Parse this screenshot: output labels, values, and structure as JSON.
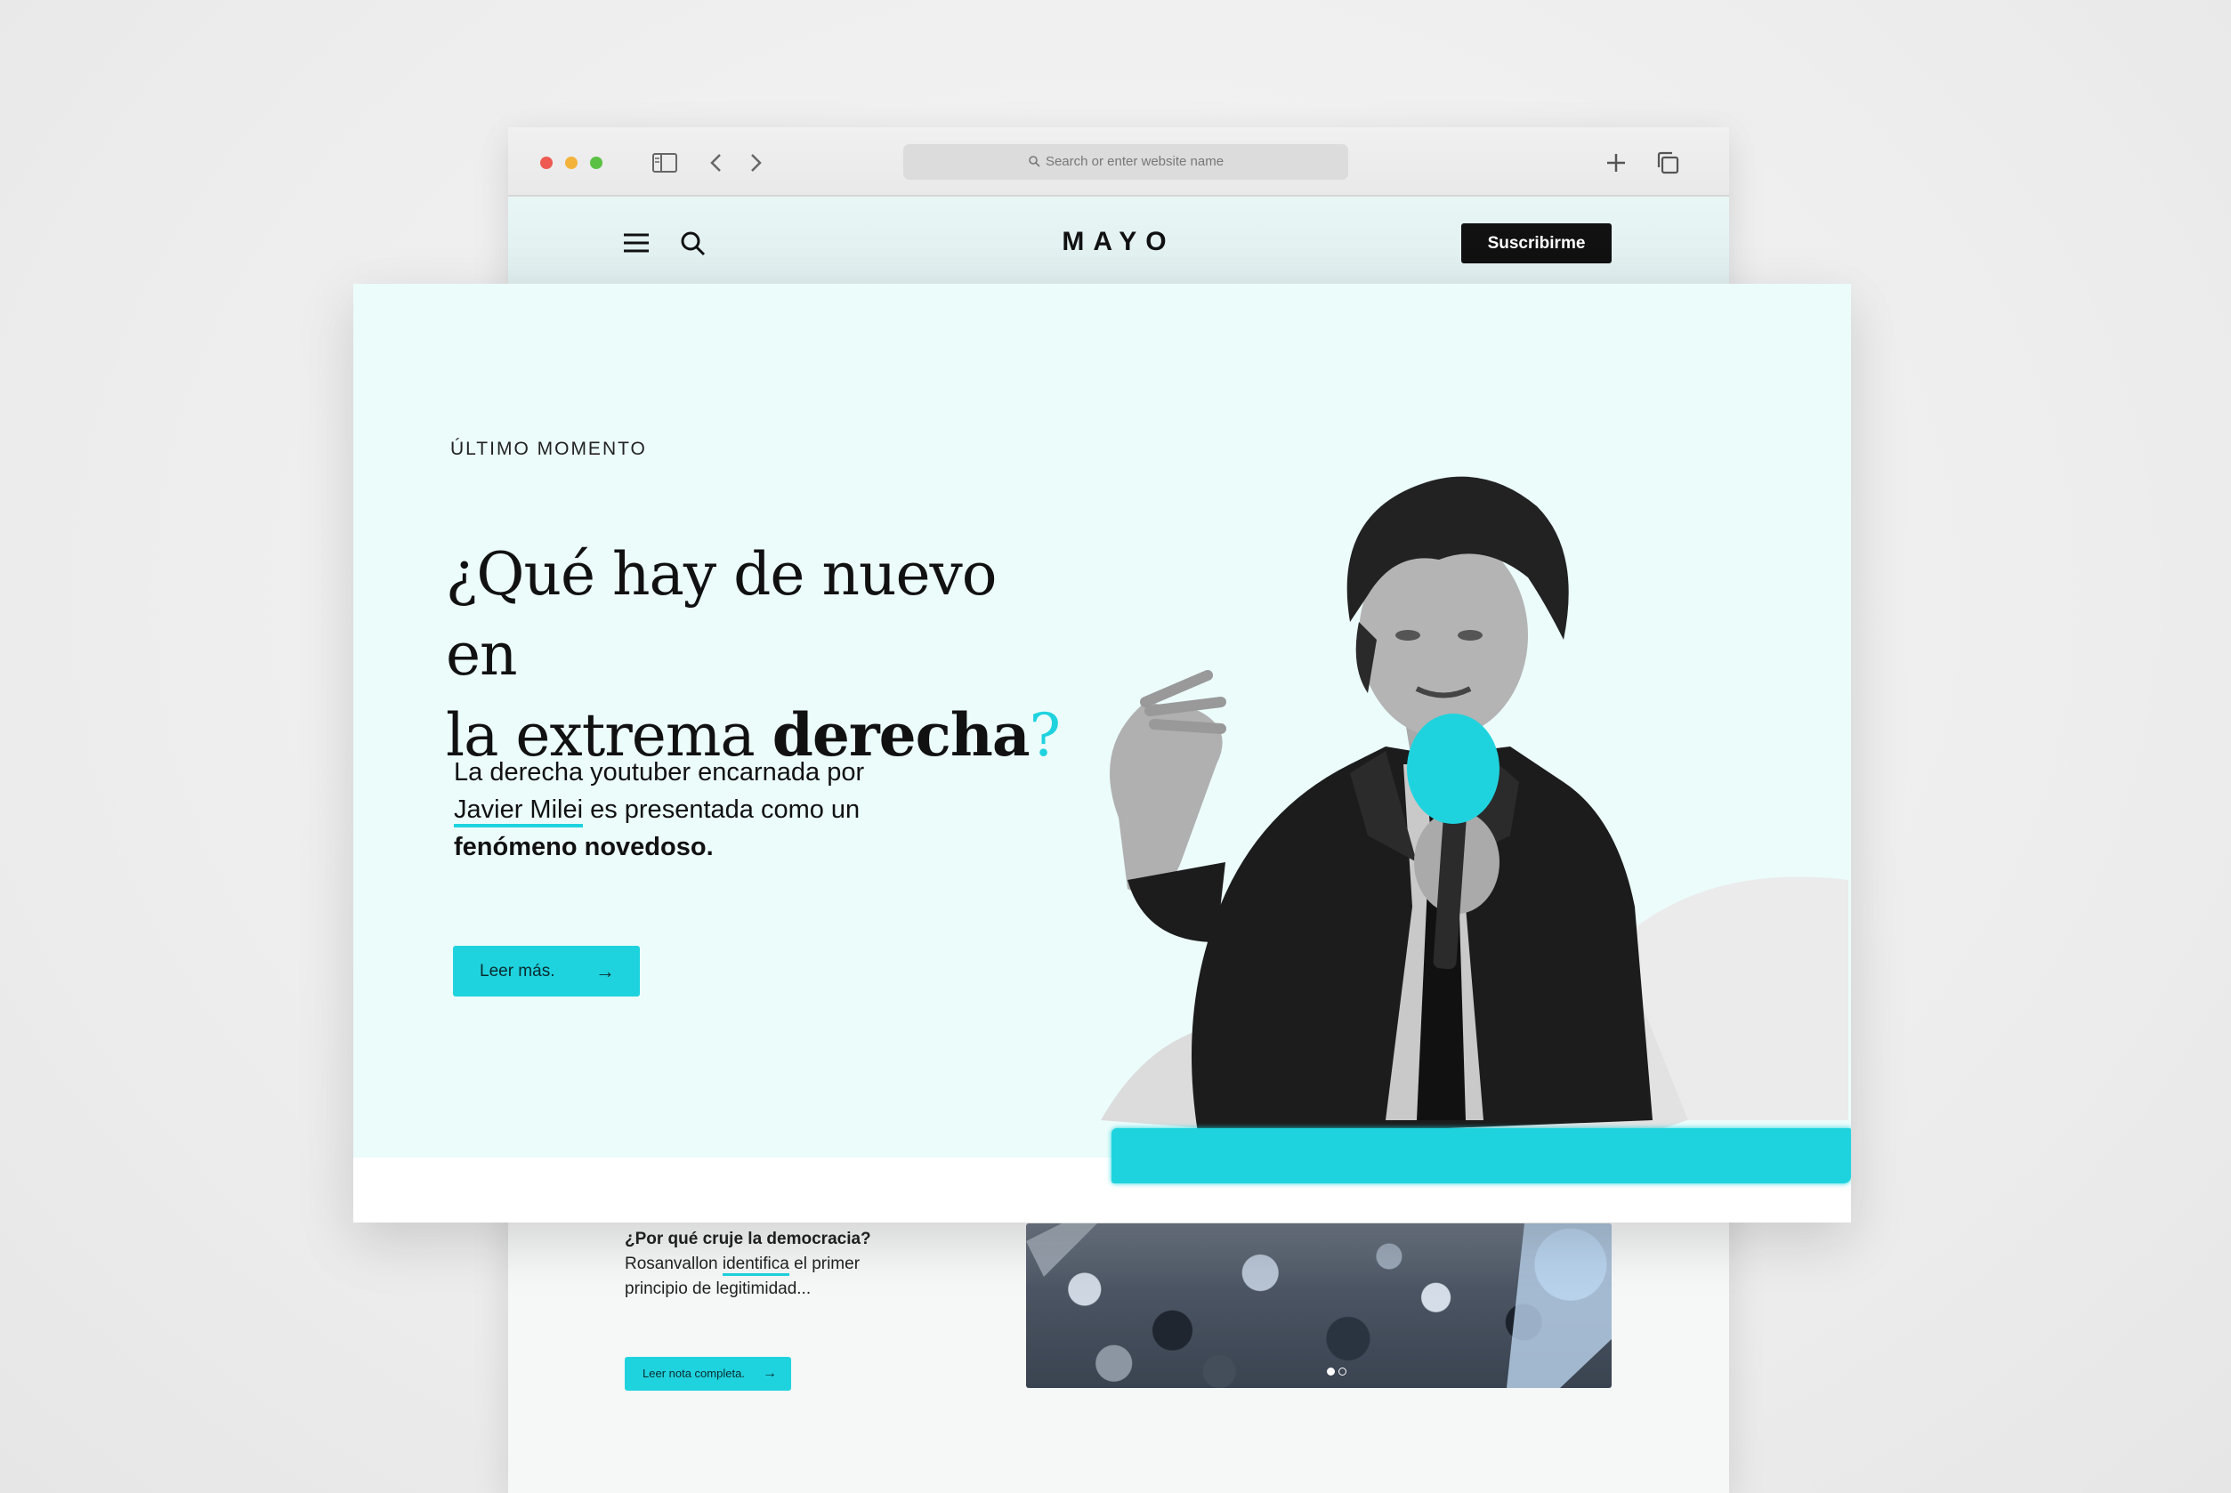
{
  "browser": {
    "url_placeholder": "Search or enter website name",
    "icons": [
      "sidebar-icon",
      "back-icon",
      "forward-icon",
      "new-tab-icon",
      "tabs-overview-icon"
    ]
  },
  "site": {
    "logo": "MAYO",
    "subscribe_label": "Suscribirme",
    "icons": [
      "menu-icon",
      "search-icon"
    ]
  },
  "hero": {
    "kicker": "ÚLTIMO MOMENTO",
    "headline_part1": "¿Qué hay de nuevo en",
    "headline_part2": "la extrema ",
    "headline_bold": "derecha",
    "headline_end": "?",
    "lead_part1": "La derecha youtuber encarnada por",
    "lead_link": "Javier Milei",
    "lead_part2": " es presentada como un",
    "lead_bold": "fenómeno novedoso.",
    "button_label": "Leer más.",
    "accent_color": "#1fd3de",
    "background_color": "#ecfcfb"
  },
  "second_article": {
    "title": "¿Por qué cruje la democracia?",
    "text_part1": "Rosanvallon ",
    "text_link": "identifica",
    "text_part2": " el primer principio de legitimidad...",
    "button_label": "Leer nota completa.",
    "pager_active": 1,
    "pager_total": 2
  }
}
